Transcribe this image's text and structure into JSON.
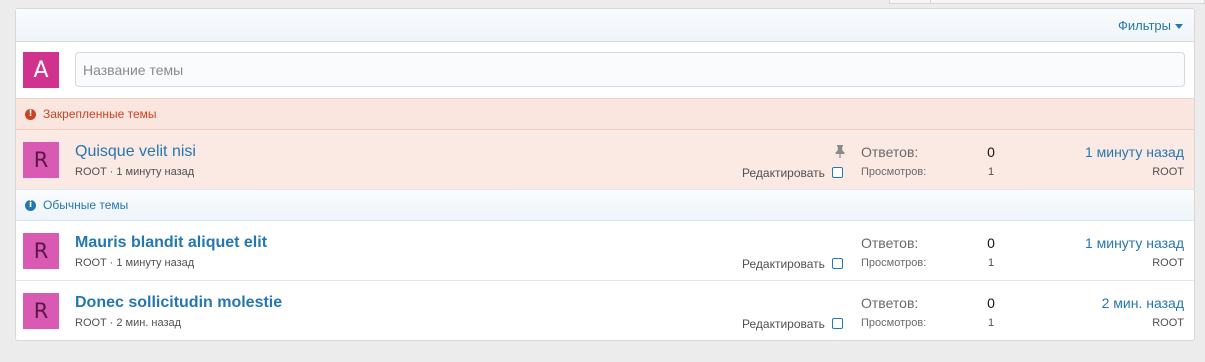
{
  "toolbar": {
    "filter_label": "Фильтры"
  },
  "new_thread": {
    "avatar_letter": "A",
    "placeholder": "Название темы"
  },
  "sections": {
    "sticky_label": "Закрепленные темы",
    "normal_label": "Обычные темы"
  },
  "threads": [
    {
      "avatar": "R",
      "title": "Quisque velit nisi",
      "author": "ROOT",
      "meta_sep": " · ",
      "time": "1 минуту назад",
      "pinned": true,
      "edit_label": "Редактировать",
      "replies_label": "Ответов:",
      "replies": "0",
      "views_label": "Просмотров:",
      "views": "1",
      "last_time": "1 минуту назад",
      "last_user": "ROOT"
    },
    {
      "avatar": "R",
      "title": "Mauris blandit aliquet elit",
      "author": "ROOT",
      "meta_sep": " · ",
      "time": "1 минуту назад",
      "pinned": false,
      "edit_label": "Редактировать",
      "replies_label": "Ответов:",
      "replies": "0",
      "views_label": "Просмотров:",
      "views": "1",
      "last_time": "1 минуту назад",
      "last_user": "ROOT"
    },
    {
      "avatar": "R",
      "title": "Donec sollicitudin molestie",
      "author": "ROOT",
      "meta_sep": " · ",
      "time": "2 мин. назад",
      "pinned": false,
      "edit_label": "Редактировать",
      "replies_label": "Ответов:",
      "replies": "0",
      "views_label": "Просмотров:",
      "views": "1",
      "last_time": "2 мин. назад",
      "last_user": "ROOT"
    }
  ],
  "colors": {
    "accent": "#2577b1",
    "sticky_text": "#c84424",
    "sticky_bg": "#fbe9e4",
    "new_avatar_bg": "#d0338d",
    "thread_avatar_bg": "#d85ab2"
  }
}
